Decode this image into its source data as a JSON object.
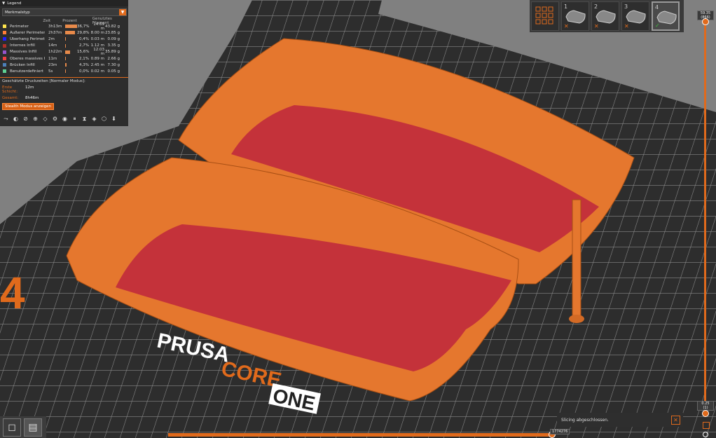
{
  "legend": {
    "title": "Legend",
    "dropdown_value": "Merkmalstyp",
    "columns": {
      "time": "Zeit",
      "percent": "Prozent",
      "filament": "Genutztes Filament"
    },
    "rows": [
      {
        "name": "Perimeter",
        "time": "3h13m",
        "pct": "36,7%",
        "pct_value": 36.7,
        "len": "14.69 m",
        "wt": "43.82 g",
        "color": "#ffe54d"
      },
      {
        "name": "Äußerer Perimeter",
        "time": "2h37m",
        "pct": "29,8%",
        "pct_value": 29.8,
        "len": "8.00 m",
        "wt": "23.85 g",
        "color": "#ff7d38"
      },
      {
        "name": "Überhang Perimeter",
        "time": "2m",
        "pct": "0,4%",
        "pct_value": 0.4,
        "len": "0.03 m",
        "wt": "0.09 g",
        "color": "#1f1fff"
      },
      {
        "name": "Internes Infill",
        "time": "14m",
        "pct": "2,7%",
        "pct_value": 2.7,
        "len": "1.12 m",
        "wt": "3.35 g",
        "color": "#b03029"
      },
      {
        "name": "Massives Infill",
        "time": "1h22m",
        "pct": "15,6%",
        "pct_value": 15.6,
        "len": "12.03 m",
        "wt": "35.89 g",
        "color": "#9654cc"
      },
      {
        "name": "Oberes massives Infill",
        "time": "11m",
        "pct": "2,1%",
        "pct_value": 2.1,
        "len": "0.89 m",
        "wt": "2.66 g",
        "color": "#f04040"
      },
      {
        "name": "Brücken Infill",
        "time": "23m",
        "pct": "4,3%",
        "pct_value": 4.3,
        "len": "2.45 m",
        "wt": "7.30 g",
        "color": "#4d80ba"
      },
      {
        "name": "Benutzerdefiniert",
        "time": "5s",
        "pct": "0,0%",
        "pct_value": 0.0,
        "len": "0.02 m",
        "wt": "0.05 g",
        "color": "#5ed194"
      }
    ],
    "estimated_title": "Geschätzte Druckzeiten [Normaler Modus]:",
    "first_layer_label": "Erste Schicht:",
    "first_layer_value": "12m",
    "total_label": "Gesamt:",
    "total_value": "8h46m",
    "stealth_button": "Stealth Modus anzeigen"
  },
  "plates": [
    {
      "num": "",
      "state": ""
    },
    {
      "num": "1",
      "state": "✕"
    },
    {
      "num": "2",
      "state": "✕"
    },
    {
      "num": "3",
      "state": "✕"
    },
    {
      "num": "4",
      "state": "✓"
    }
  ],
  "vslider": {
    "top_value": "59.35",
    "top_layer": "(866)",
    "bottom_value": "0.25",
    "bottom_layer": "(1)"
  },
  "hslider_value": "1774276",
  "notification": "Slicing abgeschlossen.",
  "bed": {
    "brand_1": "PRUSA",
    "brand_2": "CORE",
    "brand_3": "ONE",
    "plate_number": "4"
  },
  "colors": {
    "accent": "#e06a1c",
    "part": "#e5772e",
    "infill": "#c4323a"
  }
}
